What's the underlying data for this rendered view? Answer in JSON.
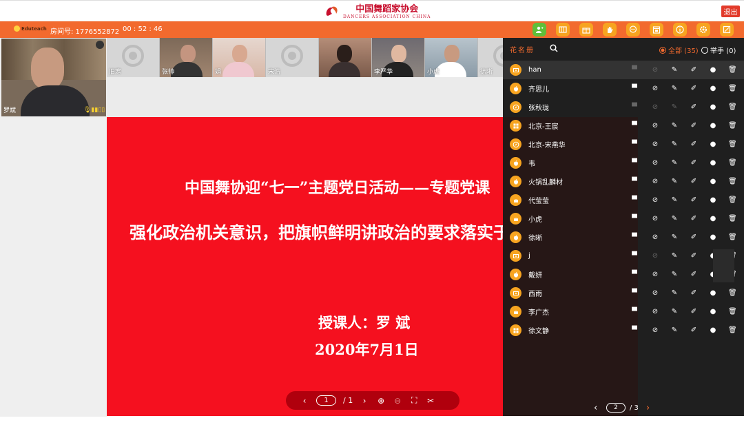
{
  "header": {
    "logo_cn": "中国舞蹈家协会",
    "logo_en": "DANCERS ASSOCIATION CHINA",
    "exit_label": "退出"
  },
  "toolbar": {
    "brand": "Eduteach",
    "room_label": "房间号: 1776552872",
    "timer": "00 : 52 : 46",
    "icons": [
      "users-icon",
      "library-icon",
      "gift-icon",
      "hand-icon",
      "chat-icon",
      "calendar-icon",
      "info-icon",
      "settings-icon",
      "fullscreen-icon"
    ]
  },
  "main_video": {
    "name": "罗斌"
  },
  "video_strip": [
    {
      "name": "旧寒",
      "live": false
    },
    {
      "name": "张帅",
      "live": true
    },
    {
      "name": "娟",
      "live": true
    },
    {
      "name": "宋浩",
      "live": false
    },
    {
      "name": "",
      "live": true
    },
    {
      "name": "李严华",
      "live": true
    },
    {
      "name": "小虎",
      "live": true
    },
    {
      "name": "徐晰",
      "live": false
    }
  ],
  "slide": {
    "title": "中国舞协迎“七一”主题党日活动——专题党课",
    "subtitle": "强化政治机关意识，把旗帜鲜明讲政治的要求落实于舞协工作",
    "lecturer": "授课人：罗 斌",
    "date": "2020年7月1日",
    "page_current": "1",
    "page_total": "/ 1"
  },
  "roster": {
    "title": "花名册",
    "filter_all": "全部 (35)",
    "filter_hand": "举手 (0)",
    "members": [
      {
        "name": "han",
        "device": "pc"
      },
      {
        "name": "齐思儿",
        "device": "apple"
      },
      {
        "name": "张秋珑",
        "device": "safari"
      },
      {
        "name": "北京-王宸",
        "device": "windows"
      },
      {
        "name": "北京-宋燕华",
        "device": "safari"
      },
      {
        "name": "韦",
        "device": "apple"
      },
      {
        "name": "火锅乱麟材",
        "device": "apple"
      },
      {
        "name": "代莹莹",
        "device": "android"
      },
      {
        "name": "小虎",
        "device": "android"
      },
      {
        "name": "徐晰",
        "device": "apple"
      },
      {
        "name": "j",
        "device": "pc"
      },
      {
        "name": "戴妍",
        "device": "apple"
      },
      {
        "name": "西雨",
        "device": "pc"
      },
      {
        "name": "李广杰",
        "device": "android"
      },
      {
        "name": "徐文静",
        "device": "windows"
      }
    ],
    "page_current": "2",
    "page_total": "/ 3"
  },
  "colors": {
    "accent": "#f26a2e",
    "slide_bg": "#f5101f",
    "roster_bg": "#1f1f1f"
  }
}
